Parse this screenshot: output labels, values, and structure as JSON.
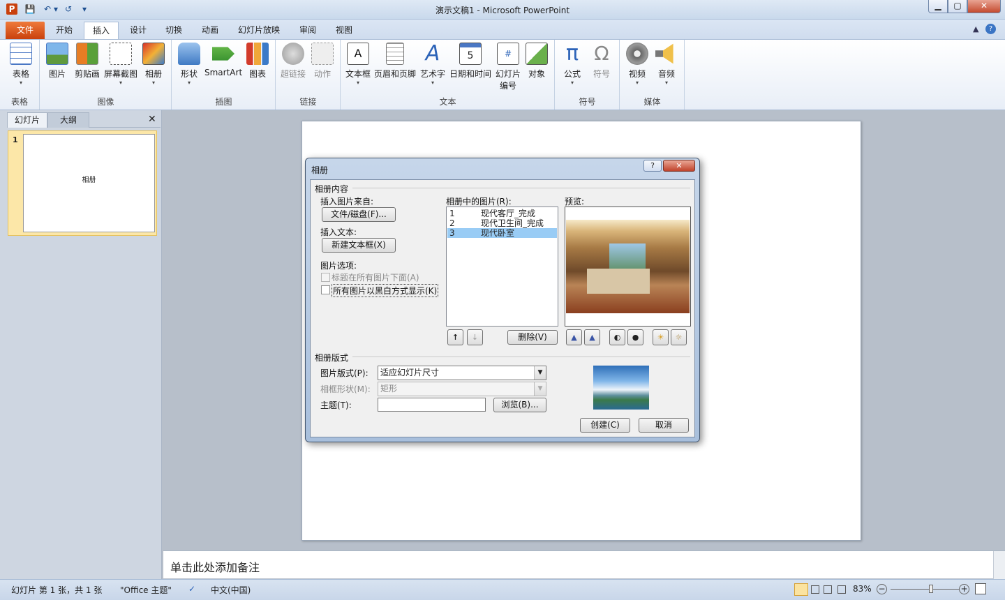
{
  "window": {
    "title": "演示文稿1 - Microsoft PowerPoint",
    "controls": {
      "minimize": "▁",
      "maximize": "▢",
      "close": "✕"
    }
  },
  "qat": {
    "logo": "P",
    "save": "💾",
    "undo": "↶",
    "redo": "↺",
    "customize": "▾"
  },
  "tabs": [
    {
      "label": "文件"
    },
    {
      "label": "开始"
    },
    {
      "label": "插入"
    },
    {
      "label": "设计"
    },
    {
      "label": "切换"
    },
    {
      "label": "动画"
    },
    {
      "label": "幻灯片放映"
    },
    {
      "label": "审阅"
    },
    {
      "label": "视图"
    }
  ],
  "ribbon": {
    "groups": {
      "tables": "表格",
      "images": "图像",
      "illustrations": "插图",
      "links": "链接",
      "text": "文本",
      "symbols": "符号",
      "media": "媒体"
    },
    "buttons": {
      "table": "表格",
      "picture": "图片",
      "clipart": "剪贴画",
      "screenshot": "屏幕截图",
      "album": "相册",
      "shapes": "形状",
      "smartart": "SmartArt",
      "chart": "图表",
      "hyperlink": "超链接",
      "action": "动作",
      "textbox": "文本框",
      "headerfooter": "页眉和页脚",
      "wordart": "艺术字",
      "datetime": "日期和时间",
      "slidenumber_1": "幻灯片",
      "slidenumber_2": "编号",
      "object": "对象",
      "equation": "公式",
      "symbol": "符号",
      "video": "视频",
      "audio": "音频"
    },
    "icons": {
      "pi": "π",
      "omega": "Ω",
      "letter_a": "A",
      "datetime_number": "5",
      "slide_number_hash": "#"
    },
    "dropdown_arrow": "▾"
  },
  "left_panel": {
    "tab_slides": "幻灯片",
    "tab_outline": "大纲",
    "close": "✕",
    "slide_number": "1",
    "slide_title": "相册"
  },
  "notes": {
    "placeholder": "单击此处添加备注"
  },
  "status": {
    "slide_info": "幻灯片 第 1 张，共 1 张",
    "theme": "\"Office 主题\"",
    "language": "中文(中国)",
    "zoom": "83%",
    "zoom_fraction": 0.6,
    "zoom_out": "−",
    "zoom_in": "+"
  },
  "dialog": {
    "title": "相册",
    "help": "?",
    "close": "✕",
    "section_content": "相册内容",
    "insert_from": "插入图片来自:",
    "file_disk_btn": "文件/磁盘(F)...",
    "insert_text": "插入文本:",
    "new_textbox_btn": "新建文本框(X)",
    "picture_options": "图片选项:",
    "caption_below": "标题在所有图片下面(A)",
    "black_white": "所有图片以黑白方式显示(K)",
    "pictures_in_album": "相册中的图片(R):",
    "pictures": [
      {
        "num": "1",
        "name": "现代客厅_完成"
      },
      {
        "num": "2",
        "name": "现代卫生间_完成"
      },
      {
        "num": "3",
        "name": "现代卧室"
      }
    ],
    "selected_picture_index": 2,
    "preview": "预览:",
    "move_up": "↑",
    "move_down": "↓",
    "delete_btn": "删除(V)",
    "section_layout": "相册版式",
    "picture_layout_label": "图片版式(P):",
    "picture_layout_value": "适应幻灯片尺寸",
    "frame_shape_label": "相框形状(M):",
    "frame_shape_value": "矩形",
    "theme_label": "主题(T):",
    "theme_value": "",
    "browse_btn": "浏览(B)...",
    "create_btn": "创建(C)",
    "cancel_btn": "取消"
  }
}
